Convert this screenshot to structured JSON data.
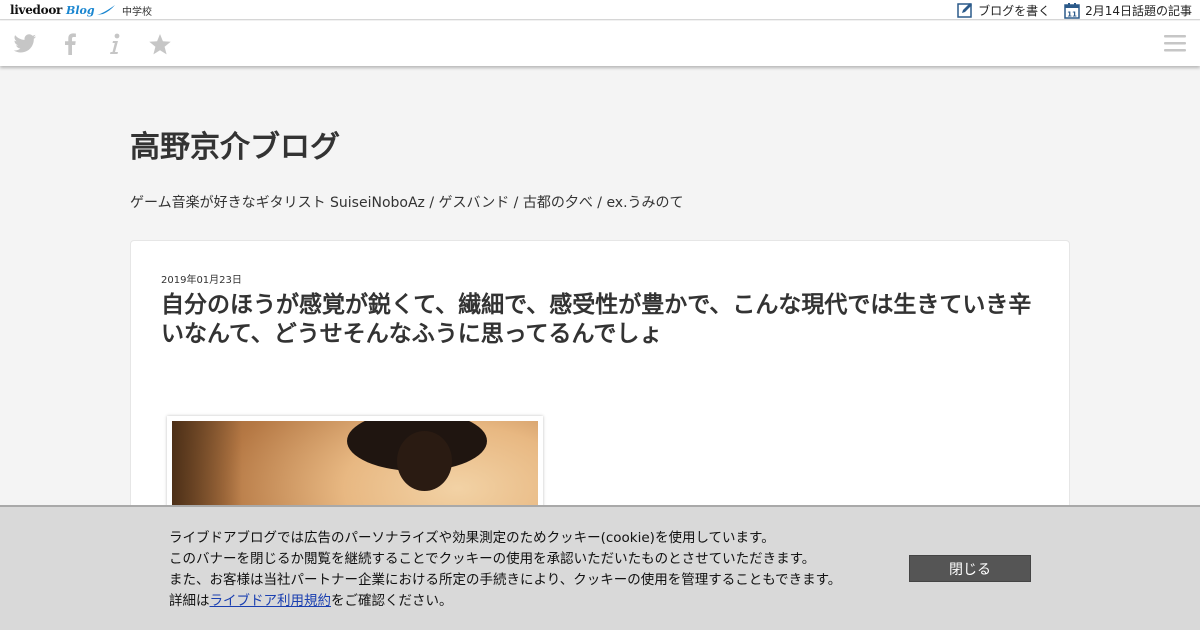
{
  "topbar": {
    "logo_text": "livedoor",
    "logo_blog": "Blog",
    "category": "中学校",
    "write_blog": "ブログを書く",
    "calendar_day": "11",
    "trending": "2月14日話題の記事"
  },
  "navbar": {
    "share_icons": [
      "twitter-icon",
      "facebook-icon",
      "info-icon",
      "star-icon"
    ],
    "menu_icon": "hamburger-menu-icon"
  },
  "blog": {
    "title": "高野京介ブログ",
    "description": "ゲーム音楽が好きなギタリスト SuiseiNoboAz / ゲスバンド / 古都の夕べ / ex.うみのて"
  },
  "post": {
    "date": "2019年01月23日",
    "title": "自分のほうが感覚が鋭くて、繊細で、感受性が豊かで、こんな現代では生きていき辛いなんて、どうせそんなふうに思ってるんでしょ"
  },
  "cookie": {
    "line1": "ライブドアブログでは広告のパーソナライズや効果測定のためクッキー(cookie)を使用しています。",
    "line2": "このバナーを閉じるか閲覧を継続することでクッキーの使用を承認いただいたものとさせていただきます。",
    "line3": "また、お客様は当社パートナー企業における所定の手続きにより、クッキーの使用を管理することもできます。",
    "line4_prefix": "詳細は",
    "line4_link": "ライブドア利用規約",
    "line4_suffix": "をご確認ください。",
    "close_label": "閉じる"
  },
  "colors": {
    "background": "#f4f4f4",
    "accent_blue": "#1a86d0",
    "banner": "#d9d9d9",
    "close_button": "#555555"
  }
}
